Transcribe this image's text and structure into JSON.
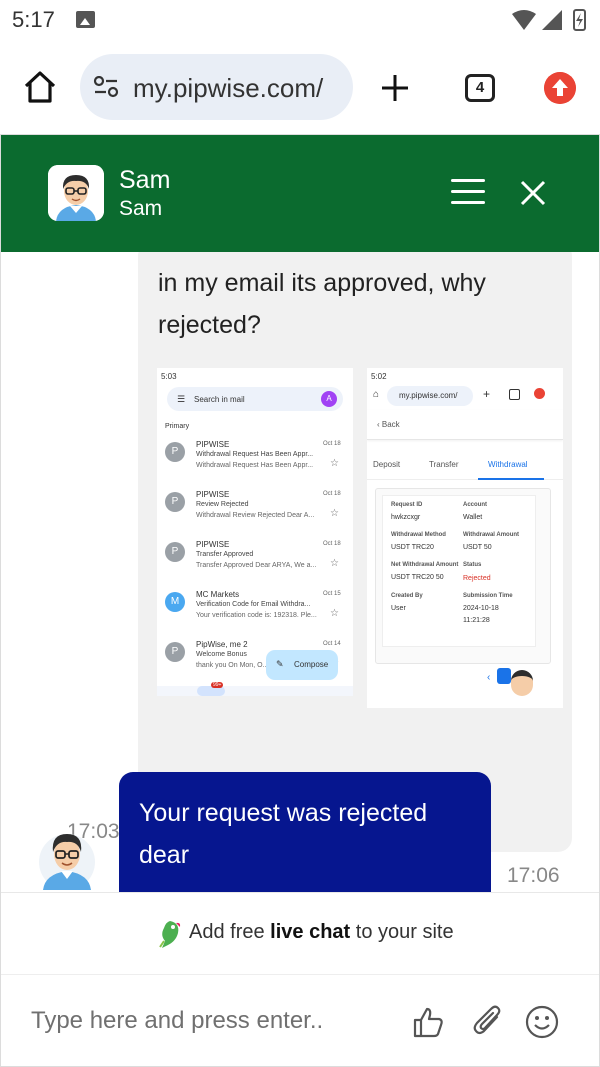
{
  "status_bar": {
    "time": "5:17"
  },
  "browser": {
    "url": "my.pipwise.com/",
    "tab_count": "4"
  },
  "chat_header": {
    "agent_name": "Sam",
    "agent_subtitle": "Sam"
  },
  "messages": {
    "incoming": {
      "text": "in my email its approved, why rejected?",
      "time": "17:03",
      "attachment": {
        "left_screen": {
          "time": "5:03",
          "search_placeholder": "Search in mail",
          "account_initial": "A",
          "section": "Primary",
          "emails": [
            {
              "initial": "P",
              "sender": "PIPWISE",
              "date": "Oct 18",
              "subject": "Withdrawal Request Has Been Appr...",
              "snippet": "Withdrawal Request Has Been Appr...",
              "color": "#9aa0a6"
            },
            {
              "initial": "P",
              "sender": "PIPWISE",
              "date": "Oct 18",
              "subject": "Review Rejected",
              "snippet": "Withdrawal Review Rejected Dear A...",
              "color": "#9aa0a6"
            },
            {
              "initial": "P",
              "sender": "PIPWISE",
              "date": "Oct 18",
              "subject": "Transfer Approved",
              "snippet": "Transfer Approved Dear ARYA, We a...",
              "color": "#9aa0a6"
            },
            {
              "initial": "M",
              "sender": "MC Markets",
              "date": "Oct 15",
              "subject": "Verification Code for Email Withdra...",
              "snippet": "Your verification code is: 192318. Ple...",
              "color": "#4aa8f0"
            },
            {
              "initial": "P",
              "sender": "PipWise, me 2",
              "date": "Oct 14",
              "subject": "Welcome Bonus",
              "snippet": "thank you On Mon, O...",
              "color": "#9aa0a6"
            }
          ],
          "compose_label": "Compose",
          "mail_badge": "99+"
        },
        "right_screen": {
          "time": "5:02",
          "url": "my.pipwise.com/",
          "back_label": "Back",
          "tabs": [
            "Deposit",
            "Transfer",
            "Withdrawal"
          ],
          "fields": {
            "request_id_label": "Request ID",
            "request_id": "hwkzcxgr",
            "account_label": "Account",
            "account": "Wallet",
            "method_label": "Withdrawal Method",
            "method": "USDT TRC20",
            "amount_label": "Withdrawal Amount",
            "amount": "USDT 50",
            "net_label": "Net Withdrawal Amount",
            "net": "USDT TRC20 50",
            "status_label": "Status",
            "status": "Rejected",
            "created_label": "Created By",
            "created": "User",
            "submission_label": "Submission Time",
            "submission_date": "2024-10-18",
            "submission_time": "11:21:28"
          }
        }
      }
    },
    "outgoing": {
      "text": "Your request was rejected dear",
      "time": "17:06"
    }
  },
  "powered_by": {
    "prefix": "Add free ",
    "bold": "live chat",
    "suffix": " to your site"
  },
  "composer": {
    "placeholder": "Type here and press enter.."
  },
  "colors": {
    "header_green": "#0b6b2f",
    "outgoing_bubble": "#06168f",
    "incoming_bubble": "#f1f1f1",
    "rejected_red": "#d93025"
  }
}
